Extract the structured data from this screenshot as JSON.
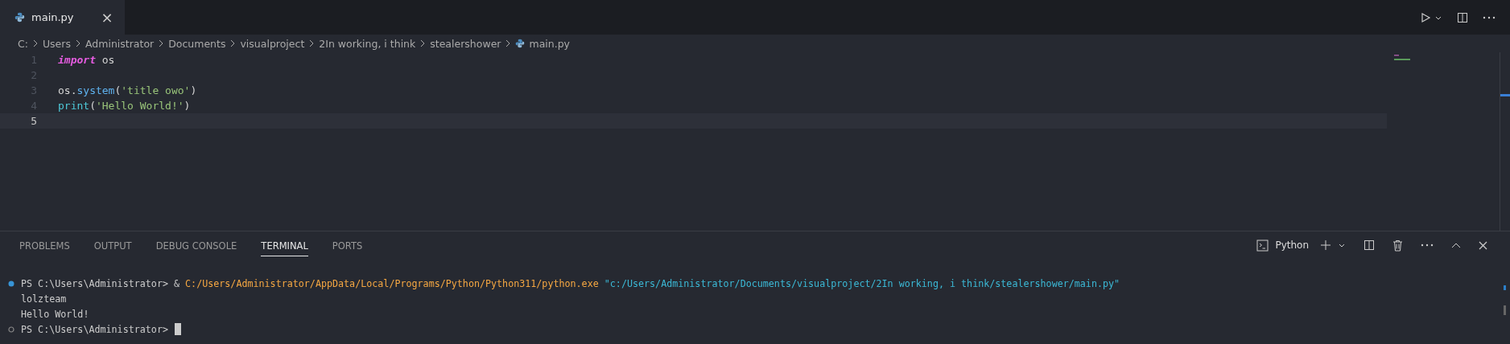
{
  "editor_tabs": [
    {
      "label": "main.py",
      "selected": true,
      "close": "×"
    }
  ],
  "breadcrumb": [
    {
      "label": "C:",
      "kind": "folder"
    },
    {
      "label": "Users",
      "kind": "folder"
    },
    {
      "label": "Administrator",
      "kind": "folder"
    },
    {
      "label": "Documents",
      "kind": "folder"
    },
    {
      "label": "visualproject",
      "kind": "folder"
    },
    {
      "label": "2In working, i think",
      "kind": "folder"
    },
    {
      "label": "stealershower",
      "kind": "folder"
    },
    {
      "label": "main.py",
      "kind": "file"
    }
  ],
  "code_lines": [
    {
      "number": "1",
      "current": false,
      "tokens": [
        {
          "text": "import",
          "kind": "keyword"
        },
        {
          "text": " os",
          "kind": "plain"
        }
      ]
    },
    {
      "number": "2",
      "current": false
    },
    {
      "number": "3",
      "current": false,
      "tokens": [
        {
          "text": "os.",
          "kind": "plain"
        },
        {
          "text": "system",
          "kind": "function"
        },
        {
          "text": "(",
          "kind": "plain"
        },
        {
          "text": "'title owo'",
          "kind": "string"
        },
        {
          "text": ")",
          "kind": "plain"
        }
      ]
    },
    {
      "number": "4",
      "current": false,
      "tokens": [
        {
          "text": "print",
          "kind": "builtin"
        },
        {
          "text": "(",
          "kind": "plain"
        },
        {
          "text": "'Hello World!'",
          "kind": "string"
        },
        {
          "text": ")",
          "kind": "plain"
        }
      ]
    },
    {
      "number": "5",
      "current": true
    }
  ],
  "panel_tabs": [
    {
      "label": "PROBLEMS",
      "selected": false
    },
    {
      "label": "OUTPUT",
      "selected": false
    },
    {
      "label": "DEBUG CONSOLE",
      "selected": false
    },
    {
      "label": "TERMINAL",
      "selected": true
    },
    {
      "label": "PORTS",
      "selected": false
    }
  ],
  "terminal_name": "Python",
  "terminal_lines": [
    {
      "kind": "succeeded",
      "segments": [
        {
          "text": "PS C:\\Users\\Administrator> & ",
          "kind": "plain"
        },
        {
          "text": "C:/Users/Administrator/AppData/Local/Programs/Python/Python311/python.exe",
          "kind": "command"
        },
        {
          "text": " \"c:/Users/Administrator/Documents/visualproject/2In working, i think/stealershower/main.py\"",
          "kind": "string"
        }
      ]
    },
    {
      "kind": "output",
      "segments": [
        {
          "text": "lolzteam",
          "kind": "plain"
        }
      ]
    },
    {
      "kind": "output",
      "segments": [
        {
          "text": "Hello World!",
          "kind": "plain"
        }
      ]
    },
    {
      "kind": "running",
      "segments": [
        {
          "text": "PS C:\\Users\\Administrator>",
          "kind": "plain"
        }
      ],
      "cursor": true
    }
  ]
}
